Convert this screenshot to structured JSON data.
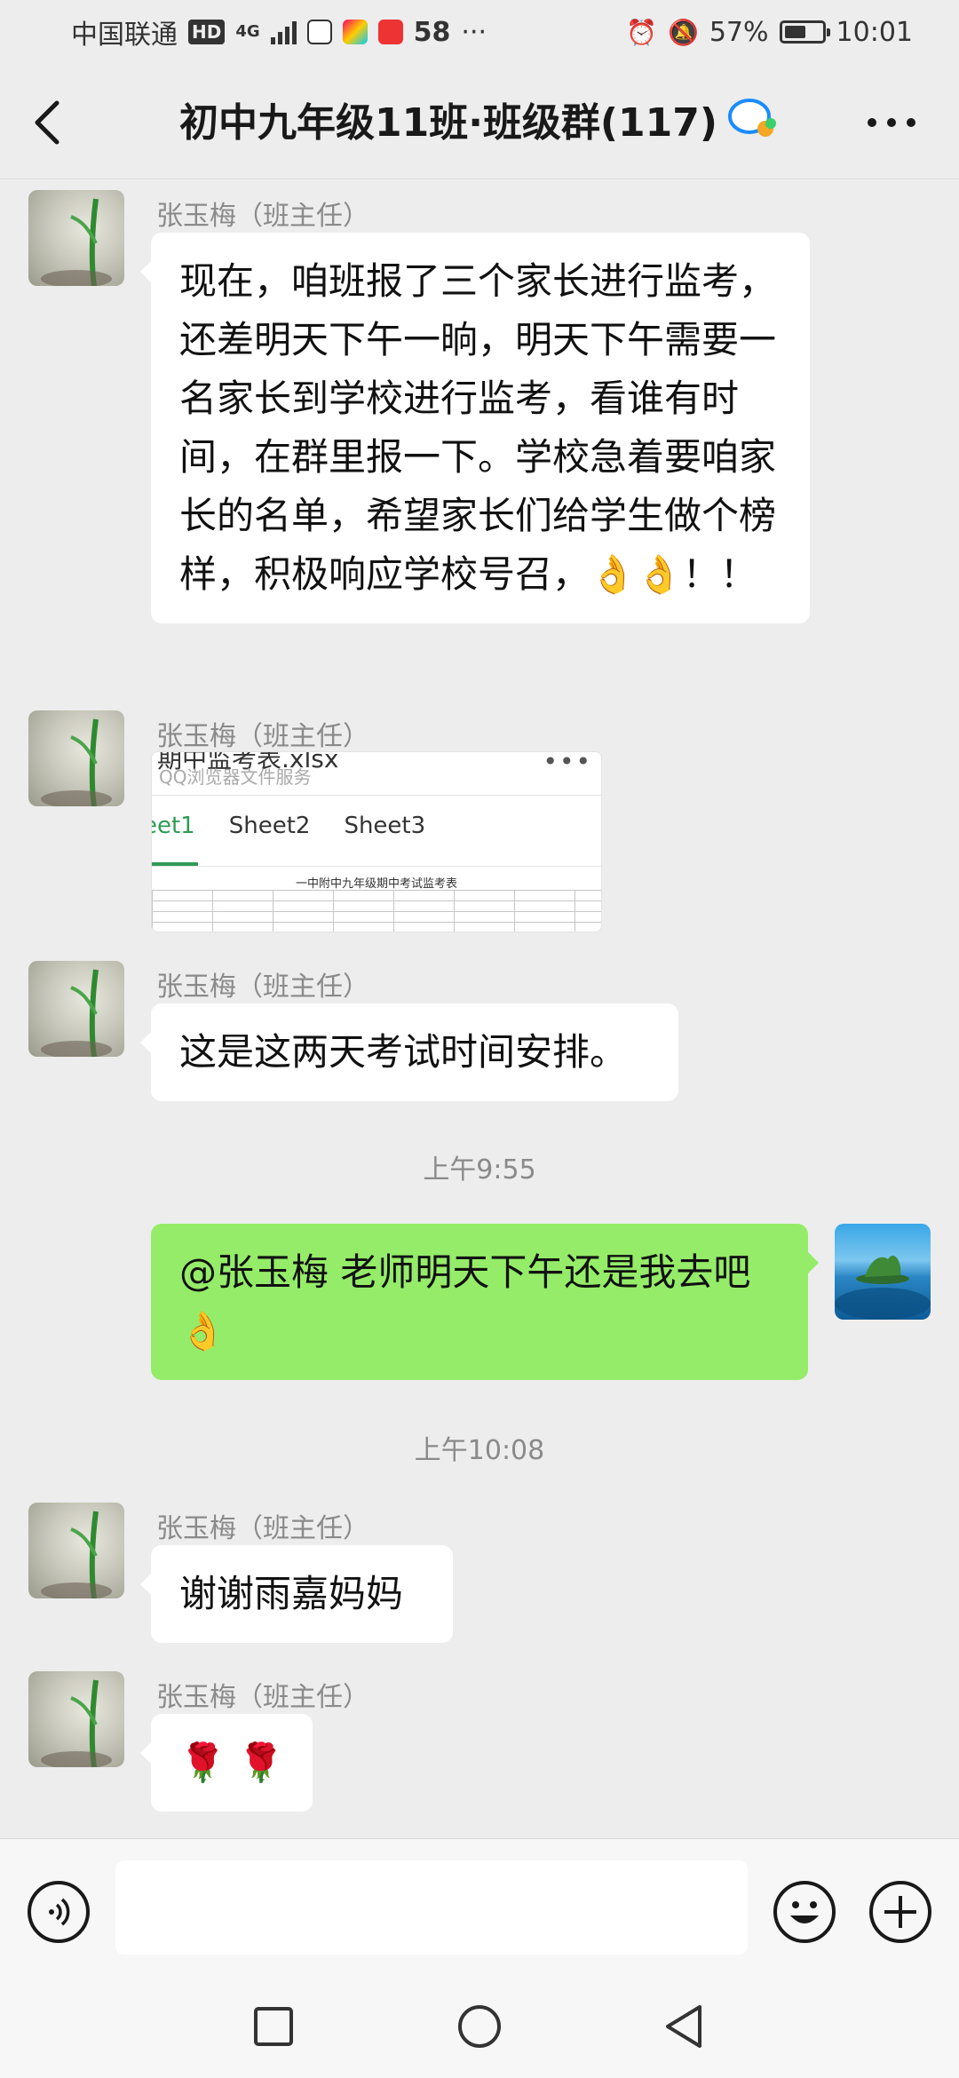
{
  "status_bar": {
    "carrier": "中国联通",
    "hd_badge": "HD",
    "network": "4G",
    "notif_count": "58",
    "battery_percent": "57%",
    "battery_level": 0.57,
    "time": "10:01",
    "overflow": "···"
  },
  "header": {
    "title": "初中九年级11班·班级群(117)"
  },
  "messages": [
    {
      "sender": "张玉梅（班主任）",
      "text": "现在，咱班报了三个家长进行监考，还差明天下午一晌，明天下午需要一名家长到学校进行监考，看谁有时间，在群里报一下。学校急着要咱家长的名单，希望家长们给学生做个榜样，积极响应学校号召，👌👌！！"
    },
    {
      "sender": "张玉梅（班主任）",
      "file": {
        "name": "期中监考表.xlsx",
        "source": "QQ浏览器文件服务",
        "tabs": [
          "eet1",
          "Sheet2",
          "Sheet3"
        ],
        "sheet_title": "一中附中九年级期中考试监考表"
      }
    },
    {
      "sender": "张玉梅（班主任）",
      "text": "这是这两天考试时间安排。"
    },
    {
      "timestamp": "上午9:55"
    },
    {
      "self": true,
      "text": "@张玉梅  老师明天下午还是我去吧👌"
    },
    {
      "timestamp": "上午10:08"
    },
    {
      "sender": "张玉梅（班主任）",
      "text": "谢谢雨嘉妈妈"
    },
    {
      "sender": "张玉梅（班主任）",
      "text": "🌹 🌹"
    }
  ]
}
